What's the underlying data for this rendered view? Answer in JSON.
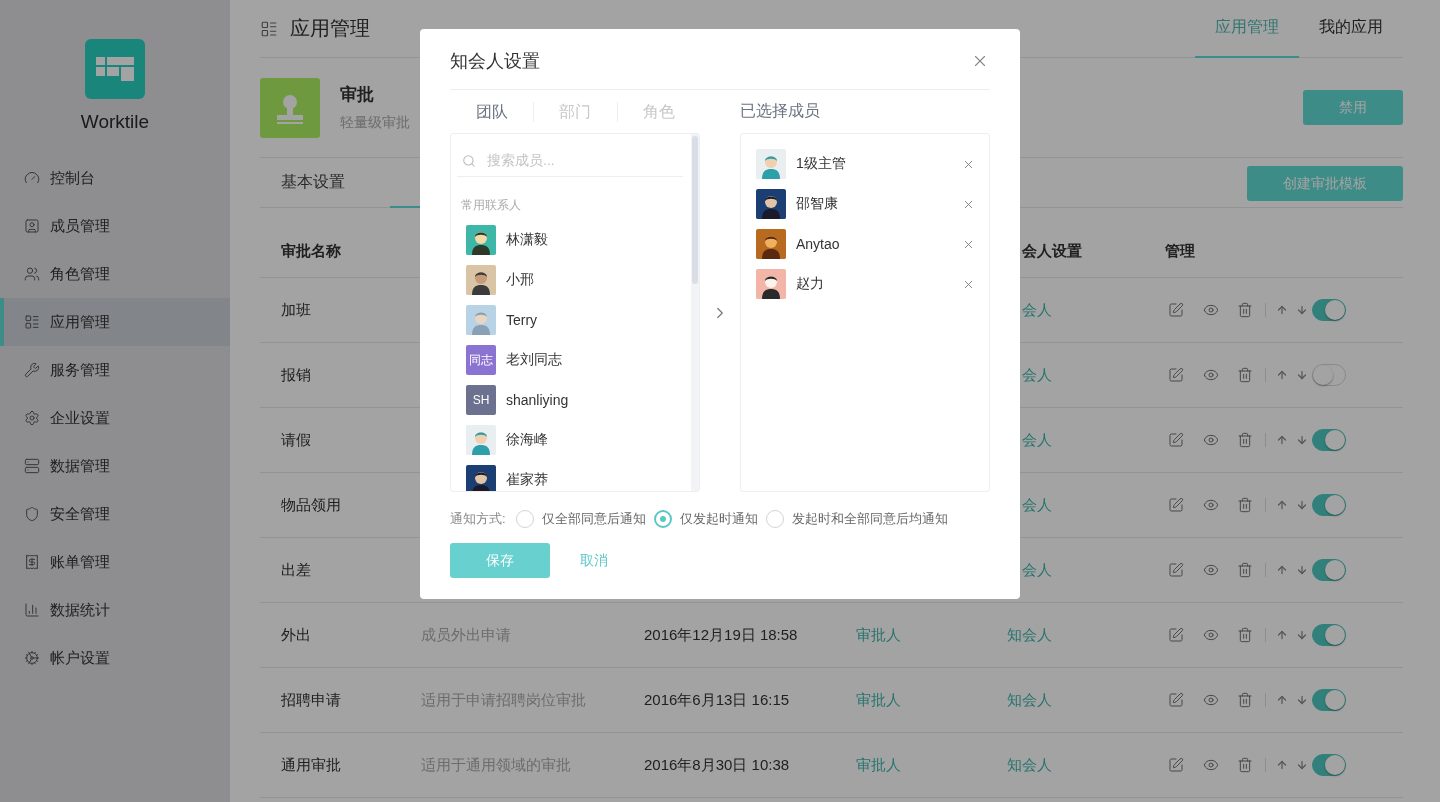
{
  "sidebar": {
    "brand": "Worktile",
    "items": [
      {
        "label": "控制台",
        "selected": false
      },
      {
        "label": "成员管理",
        "selected": false
      },
      {
        "label": "角色管理",
        "selected": false
      },
      {
        "label": "应用管理",
        "selected": true
      },
      {
        "label": "服务管理",
        "selected": false
      },
      {
        "label": "企业设置",
        "selected": false
      },
      {
        "label": "数据管理",
        "selected": false
      },
      {
        "label": "安全管理",
        "selected": false
      },
      {
        "label": "账单管理",
        "selected": false
      },
      {
        "label": "数据统计",
        "selected": false
      },
      {
        "label": "帐户设置",
        "selected": false
      }
    ]
  },
  "header": {
    "title": "应用管理",
    "tabs": [
      {
        "label": "应用管理",
        "selected": true
      },
      {
        "label": "我的应用",
        "selected": false
      }
    ]
  },
  "app": {
    "name": "审批",
    "description": "轻量级审批",
    "button": "禁用"
  },
  "sub_tabs": [
    {
      "label": "基本设置",
      "selected": false
    },
    {
      "selected": true
    }
  ],
  "create_button": "创建审批模板",
  "table": {
    "columns": {
      "name": "审批名称",
      "cc": "会人设置",
      "manage": "管理"
    },
    "rows": [
      {
        "name": "加班",
        "cc": "会人",
        "enabled": true
      },
      {
        "name": "报销",
        "cc": "会人",
        "enabled": false
      },
      {
        "name": "请假",
        "cc": "会人",
        "enabled": true
      },
      {
        "name": "物品领用",
        "cc": "会人",
        "enabled": true
      },
      {
        "name": "出差",
        "cc": "会人",
        "enabled": true
      },
      {
        "name": "外出",
        "description": "成员外出申请",
        "date": "2016年12月19日 18:58",
        "approver": "审批人",
        "cc": "知会人",
        "enabled": true
      },
      {
        "name": "招聘申请",
        "description": "适用于申请招聘岗位审批",
        "date": "2016年6月13日 16:15",
        "approver": "审批人",
        "cc": "知会人",
        "enabled": true
      },
      {
        "name": "通用审批",
        "description": "适用于通用领域的审批",
        "date": "2016年8月30日 10:38",
        "approver": "审批人",
        "cc": "知会人",
        "enabled": true
      }
    ]
  },
  "dialog": {
    "title": "知会人设置",
    "source_tabs": [
      {
        "label": "团队",
        "selected": true
      },
      {
        "label": "部门",
        "selected": false
      },
      {
        "label": "角色",
        "selected": false
      }
    ],
    "selected_title": "已选择成员",
    "search": {
      "placeholder": "搜索成员..."
    },
    "group_label": "常用联系人",
    "members": [
      {
        "name": "林潇毅"
      },
      {
        "name": "小邢"
      },
      {
        "name": "Terry"
      },
      {
        "name": "老刘同志",
        "avatar": {
          "kind": "initials",
          "text": "同志",
          "color": "#8b73d1"
        }
      },
      {
        "name": "shanliying",
        "avatar": {
          "kind": "initials",
          "text": "SH",
          "color": "#6c7190"
        }
      },
      {
        "name": "徐海峰"
      },
      {
        "name": "崔家莽"
      }
    ],
    "chosen": [
      {
        "name": "1级主管"
      },
      {
        "name": "邵智康"
      },
      {
        "name": "Anytao"
      },
      {
        "name": "赵力"
      }
    ],
    "notify": {
      "label": "通知方式:",
      "options": [
        {
          "label": "仅全部同意后通知",
          "selected": false
        },
        {
          "label": "仅发起时通知",
          "selected": true
        },
        {
          "label": "发起时和全部同意后均通知",
          "selected": false
        }
      ]
    },
    "save": "保存",
    "cancel": "取消"
  }
}
